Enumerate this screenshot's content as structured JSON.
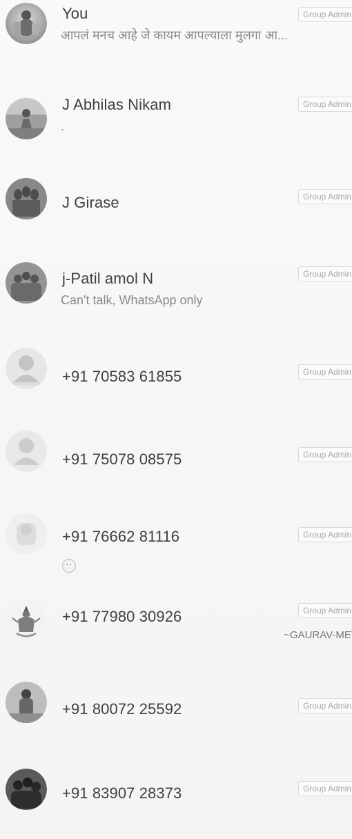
{
  "participants": [
    {
      "name": "You",
      "status": "आपलं मनच आहे जे कायम आपल्याला मुलगा आ...",
      "badge": "Group Admin",
      "avatar_icon": "person-photo-icon"
    },
    {
      "name": "J Abhilas Nikam",
      "status": ".",
      "badge": "Group Admin",
      "avatar_icon": "person-photo-icon"
    },
    {
      "name": "J Girase",
      "status": "",
      "badge": "Group Admin",
      "avatar_icon": "group-photo-icon"
    },
    {
      "name": "j-Patil amol N",
      "status": "Can't talk, WhatsApp only",
      "badge": "Group Admin",
      "avatar_icon": "group-photo-icon"
    },
    {
      "name": "+91 70583 61855",
      "status": "",
      "badge": "Group Admin",
      "avatar_icon": "default-avatar-icon"
    },
    {
      "name": "+91 75078 08575",
      "status": "",
      "badge": "Group Admin",
      "avatar_icon": "default-avatar-icon"
    },
    {
      "name": "+91 76662 81116",
      "status": "",
      "badge": "Group Admin",
      "avatar_icon": "default-avatar-icon",
      "emoji_icon": "smile-emoji-icon"
    },
    {
      "name": "+91 77980 30926",
      "status": "",
      "badge": "Group Admin",
      "subname": "~GAURAV-MET",
      "avatar_icon": "deity-illustration-icon"
    },
    {
      "name": "+91 80072 25592",
      "status": "",
      "badge": "Group Admin",
      "avatar_icon": "person-photo-icon"
    },
    {
      "name": "+91 83907 28373",
      "status": "",
      "badge": "Group Admin",
      "avatar_icon": "group-photo-icon"
    }
  ]
}
